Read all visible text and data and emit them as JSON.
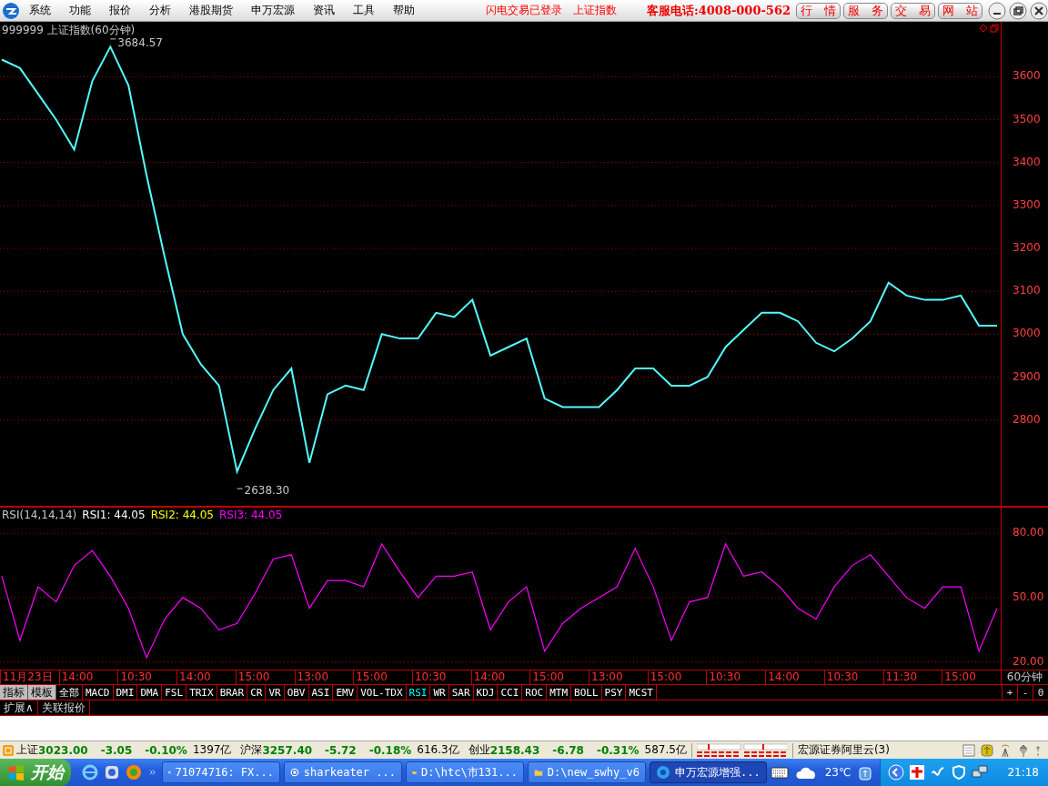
{
  "menu_bar": {
    "items": [
      "系统",
      "功能",
      "报价",
      "分析",
      "港股期货",
      "申万宏源",
      "资讯",
      "工具",
      "帮助"
    ],
    "login_status": "闪电交易已登录",
    "index_link": "上证指数",
    "hotline": "客服电话:4008-000-562",
    "buttons": [
      "行　情",
      "服　务",
      "交　易",
      "网　站"
    ]
  },
  "price_panel": {
    "title": "999999 上证指数(60分钟)",
    "chart_data": {
      "type": "line",
      "ylim": [
        2600,
        3728
      ],
      "yticks": [
        2800,
        2900,
        3000,
        3100,
        3200,
        3300,
        3400,
        3500,
        3600
      ],
      "series": [
        {
          "color": "#54fcfc",
          "values": [
            3640,
            3620,
            3560,
            3500,
            3430,
            3590,
            3670,
            3580,
            3370,
            3180,
            3000,
            2930,
            2880,
            2680,
            2780,
            2870,
            2920,
            2700,
            2860,
            2880,
            2870,
            3000,
            2990,
            2990,
            3050,
            3040,
            3080,
            2950,
            2970,
            2990,
            2850,
            2830,
            2830,
            2830,
            2870,
            2920,
            2920,
            2880,
            2880,
            2900,
            2970,
            3010,
            3050,
            3050,
            3030,
            2980,
            2960,
            2990,
            3030,
            3120,
            3090,
            3080,
            3080,
            3090,
            3020,
            3020
          ]
        }
      ],
      "grid": true,
      "annotations": [
        {
          "text": "3684.57"
        },
        {
          "text": "2638.30"
        }
      ]
    }
  },
  "rsi_panel": {
    "label": "RSI(14,14,14)",
    "readings": [
      {
        "text": "RSI1: 44.05",
        "color": "#ffffff"
      },
      {
        "text": "RSI2: 44.05",
        "color": "#ffff00"
      },
      {
        "text": "RSI3: 44.05",
        "color": "#ff00ff"
      }
    ],
    "chart_data": {
      "type": "line",
      "grid": true,
      "ylim": [
        16,
        92
      ],
      "yticks": [
        {
          "value": 20,
          "label": "20.00"
        },
        {
          "value": 50,
          "label": "50.00"
        },
        {
          "value": 80,
          "label": "80.00"
        }
      ],
      "series": [
        {
          "color": "#ff00ff",
          "values": [
            60,
            30,
            55,
            48,
            65,
            72,
            60,
            45,
            22,
            40,
            50,
            45,
            35,
            38,
            52,
            68,
            70,
            45,
            58,
            58,
            55,
            75,
            62,
            50,
            60,
            60,
            62,
            35,
            48,
            55,
            25,
            38,
            45,
            50,
            55,
            73,
            55,
            30,
            48,
            50,
            75,
            60,
            62,
            55,
            45,
            40,
            55,
            65,
            70,
            60,
            50,
            45,
            55,
            55,
            25,
            45
          ]
        }
      ]
    }
  },
  "time_axis": {
    "labels": [
      "11月23日",
      "14:00",
      "10:30",
      "14:00",
      "15:00",
      "13:00",
      "15:00",
      "10:30",
      "14:00",
      "15:00",
      "13:00",
      "15:00",
      "10:30",
      "14:00",
      "10:30",
      "11:30",
      "15:00"
    ],
    "period": "60分钟"
  },
  "indicator_tabs": [
    {
      "label": "指标",
      "kind": "group",
      "selected": false
    },
    {
      "label": "模板",
      "kind": "group",
      "selected": false
    },
    {
      "label": "全部",
      "kind": "indicator",
      "selected": false
    },
    {
      "label": "MACD",
      "kind": "indicator",
      "selected": false
    },
    {
      "label": "DMI",
      "kind": "indicator",
      "selected": false
    },
    {
      "label": "DMA",
      "kind": "indicator",
      "selected": false
    },
    {
      "label": "FSL",
      "kind": "indicator",
      "selected": false
    },
    {
      "label": "TRIX",
      "kind": "indicator",
      "selected": false
    },
    {
      "label": "BRAR",
      "kind": "indicator",
      "selected": false
    },
    {
      "label": "CR",
      "kind": "indicator",
      "selected": false
    },
    {
      "label": "VR",
      "kind": "indicator",
      "selected": false
    },
    {
      "label": "OBV",
      "kind": "indicator",
      "selected": false
    },
    {
      "label": "ASI",
      "kind": "indicator",
      "selected": false
    },
    {
      "label": "EMV",
      "kind": "indicator",
      "selected": false
    },
    {
      "label": "VOL-TDX",
      "kind": "indicator",
      "selected": false
    },
    {
      "label": "RSI",
      "kind": "indicator",
      "selected": true
    },
    {
      "label": "WR",
      "kind": "indicator",
      "selected": false
    },
    {
      "label": "SAR",
      "kind": "indicator",
      "selected": false
    },
    {
      "label": "KDJ",
      "kind": "indicator",
      "selected": false
    },
    {
      "label": "CCI",
      "kind": "indicator",
      "selected": false
    },
    {
      "label": "ROC",
      "kind": "indicator",
      "selected": false
    },
    {
      "label": "MTM",
      "kind": "indicator",
      "selected": false
    },
    {
      "label": "BOLL",
      "kind": "indicator",
      "selected": false
    },
    {
      "label": "PSY",
      "kind": "indicator",
      "selected": false
    },
    {
      "label": "MCST",
      "kind": "indicator",
      "selected": false
    }
  ],
  "zoom_buttons": [
    "+",
    "-",
    "0"
  ],
  "bottom_tabs": [
    "扩展∧",
    "关联报价"
  ],
  "status_bar": {
    "markets": [
      {
        "name": "上证",
        "value": "3023.00",
        "change": "-3.05",
        "percent": "-0.10%",
        "amount": "1397亿"
      },
      {
        "name": "沪深",
        "value": "3257.40",
        "change": "-5.72",
        "percent": "-0.18%",
        "amount": "616.3亿"
      },
      {
        "name": "创业",
        "value": "2158.43",
        "change": "-6.78",
        "percent": "-0.31%",
        "amount": "587.5亿"
      }
    ],
    "server": "宏源证券阿里云(3)"
  },
  "taskbar": {
    "start": "开始",
    "tasks": [
      {
        "label": "71074716: FX...",
        "selected": false
      },
      {
        "label": "sharkeater ...",
        "selected": false
      },
      {
        "label": "D:\\htc\\市131...",
        "selected": false
      },
      {
        "label": "D:\\new_swhy_v6",
        "selected": false
      },
      {
        "label": "申万宏源增强...",
        "selected": true
      }
    ],
    "temperature": "23℃",
    "clock": "21:18"
  }
}
